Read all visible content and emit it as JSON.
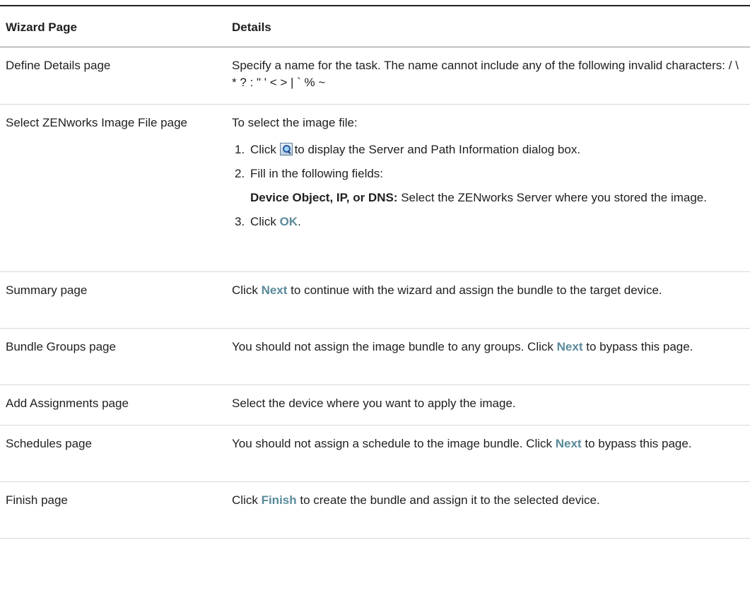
{
  "table": {
    "headers": {
      "wizard_page": "Wizard Page",
      "details": "Details"
    },
    "rows": [
      {
        "page": "Define Details page",
        "details": "Specify a name for the task. The name cannot include any of the following invalid characters: / \\ * ? : \" ' < > | ` % ~"
      },
      {
        "page": "Select ZENworks Image File page",
        "intro": "To select the image file:",
        "step1_num": "1.",
        "step1_a": "Click",
        "step1_icon": "search-icon",
        "step1_b": "to display the Server and Path Information dialog box.",
        "step2_num": "2.",
        "step2_text": "Fill in the following fields:",
        "field_label": "Device Object, IP, or DNS:",
        "field_desc": "Select the ZENworks Server where you stored the image.",
        "step3_num": "3.",
        "step3_a": "Click",
        "step3_ui": "OK",
        "step3_b": "."
      },
      {
        "page": "Summary page",
        "d_a": "Click",
        "d_ui": "Next",
        "d_b": "to continue with the wizard and assign the bundle to the target device."
      },
      {
        "page": "Bundle Groups page",
        "d_a": "You should not assign the image bundle to any groups. Click",
        "d_ui": "Next",
        "d_b": "to bypass this page."
      },
      {
        "page": "Add Assignments page",
        "details": "Select the device where you want to apply the image."
      },
      {
        "page": "Schedules page",
        "d_a": "You should not assign a schedule to the image bundle. Click",
        "d_ui": "Next",
        "d_b": "to bypass this page."
      },
      {
        "page": "Finish page",
        "d_a": "Click",
        "d_ui": "Finish",
        "d_b": "to create the bundle and assign it to the selected device."
      }
    ]
  },
  "colors": {
    "ui_text": "#5a8a9a",
    "rule": "#222222",
    "row_border": "#d8d8d8"
  }
}
